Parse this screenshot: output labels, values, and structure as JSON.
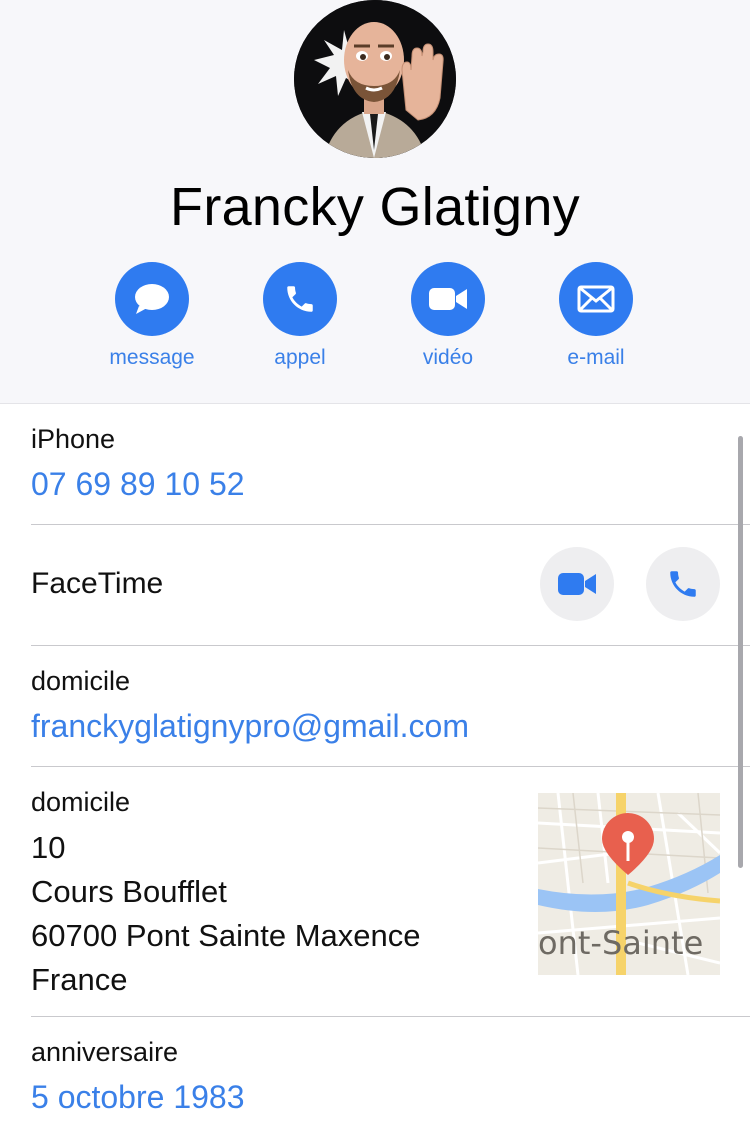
{
  "contact": {
    "name": "Francky Glatigny"
  },
  "actions": [
    {
      "label": "message",
      "icon": "message-icon"
    },
    {
      "label": "appel",
      "icon": "phone-icon"
    },
    {
      "label": "vidéo",
      "icon": "video-icon"
    },
    {
      "label": "e-mail",
      "icon": "mail-icon"
    }
  ],
  "phone": {
    "label": "iPhone",
    "value": "07 69 89 10 52"
  },
  "facetime": {
    "label": "FaceTime"
  },
  "email": {
    "label": "domicile",
    "value": "franckyglatignypro@gmail.com"
  },
  "address": {
    "label": "domicile",
    "lines": [
      "10",
      "Cours Boufflet",
      "60700 Pont Sainte Maxence",
      "France"
    ],
    "map_label": "ont-Sainte"
  },
  "birthday": {
    "label": "anniversaire",
    "value": "5 octobre 1983"
  },
  "colors": {
    "accent": "#2f7bf0",
    "link": "#3a80e8",
    "header_bg": "#f7f7fa",
    "pin": "#e8604e"
  }
}
